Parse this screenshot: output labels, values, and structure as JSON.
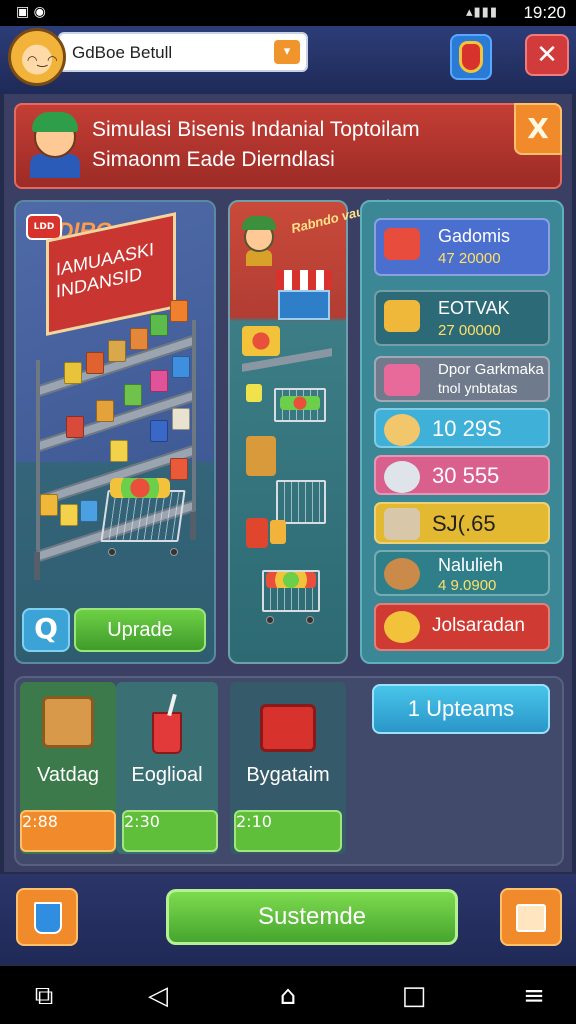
{
  "status_bar": {
    "time": "19:20",
    "signal_glyphs": "▴▮▮▮",
    "left_icons": "▣ ◉"
  },
  "header": {
    "search_value": "GdBoe Betull",
    "search_button_icon": "chevron-down-icon"
  },
  "banner": {
    "title": "Simulasi Bisenis Indanial Toptoilam",
    "subtitle": "Simaonm Eade Dierndlasi",
    "close_glyph": "X"
  },
  "store": {
    "logo_text": "LDD",
    "sign_small": "LDIRO",
    "sign_text": "IAMUAASKI INDANSID",
    "refresh_glyph": "Q",
    "upgrade_label": "Uprade"
  },
  "products": {
    "sign_text": "Rabndo vauhisd"
  },
  "stats": [
    {
      "title": "Gadomis",
      "value": "47 20000",
      "bg": "#4a6fcf"
    },
    {
      "title": "EOTVAK",
      "value": "27 00000",
      "bg": "#2c6a78"
    },
    {
      "title": "Dpor Garkmaka",
      "value": "tnol ynbtatas",
      "bg": "#6f7b8c"
    },
    {
      "title": "10 29S",
      "value": "",
      "bg": "#3fb0d8"
    },
    {
      "title": "30 555",
      "value": "",
      "bg": "#d95f8d"
    },
    {
      "title": "SJ(.65",
      "value": "",
      "bg": "#e3b932"
    },
    {
      "title": "Nalulieh",
      "value": "4 9.0900",
      "bg": "#2f7f8a"
    },
    {
      "title": "Jolsaradan",
      "value": "",
      "bg": "#cf3a33"
    }
  ],
  "bottom": {
    "slots": [
      {
        "label": "Vatdag",
        "time": "2:88"
      },
      {
        "label": "Eoglioal",
        "time": "2:30"
      },
      {
        "label": "Bygataim",
        "time": "2:10"
      }
    ],
    "upcams_label": "1 Upteams"
  },
  "action_bar": {
    "main_label": "Sustemde"
  },
  "colors": {
    "accent_orange": "#f08a2a",
    "accent_green": "#46a52e",
    "accent_red": "#cf3a33",
    "accent_blue": "#2a96c8"
  }
}
